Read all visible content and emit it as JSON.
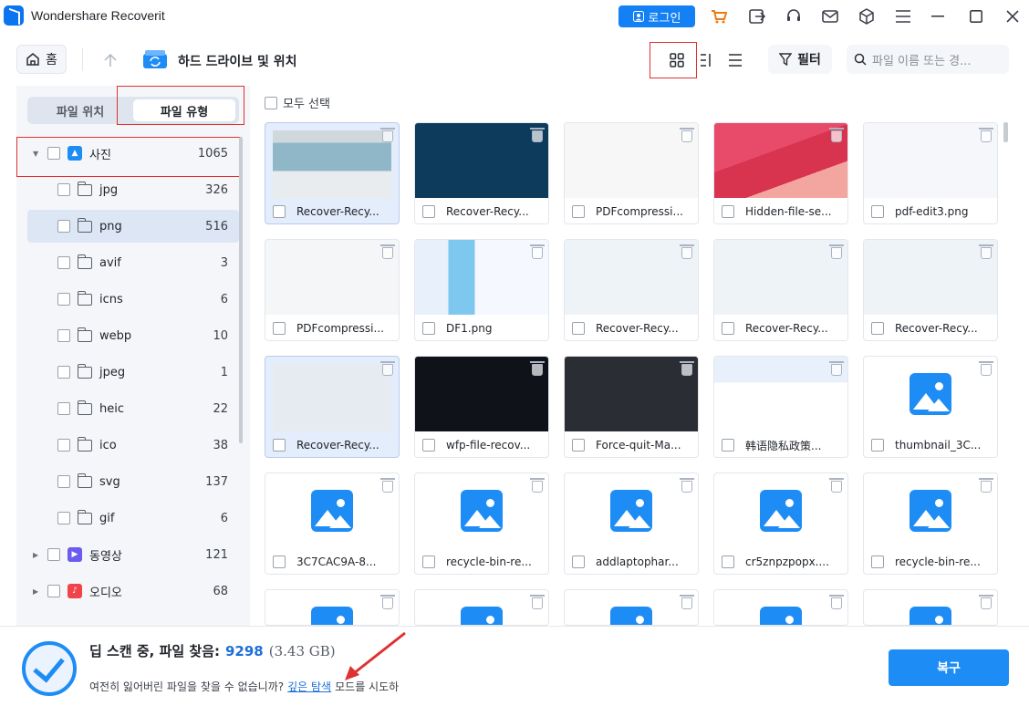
{
  "app": {
    "title": "Wondershare Recoverit",
    "login_label": "로그인"
  },
  "toolbar": {
    "home_label": "홈",
    "location_title": "하드 드라이브 및 위치",
    "filter_label": "필터",
    "search_placeholder": "파일 이름 또는 경..."
  },
  "sidebar": {
    "tabs": [
      {
        "label": "파일 위치"
      },
      {
        "label": "파일 유형"
      }
    ],
    "photo": {
      "label": "사진",
      "count": "1065"
    },
    "subtypes": [
      {
        "label": "jpg",
        "count": "326"
      },
      {
        "label": "png",
        "count": "516"
      },
      {
        "label": "avif",
        "count": "3"
      },
      {
        "label": "icns",
        "count": "6"
      },
      {
        "label": "webp",
        "count": "10"
      },
      {
        "label": "jpeg",
        "count": "1"
      },
      {
        "label": "heic",
        "count": "22"
      },
      {
        "label": "ico",
        "count": "38"
      },
      {
        "label": "svg",
        "count": "137"
      },
      {
        "label": "gif",
        "count": "6"
      }
    ],
    "video": {
      "label": "동영상",
      "count": "121"
    },
    "audio": {
      "label": "오디오",
      "count": "68"
    }
  },
  "main": {
    "select_all_label": "모두 선택",
    "files": [
      {
        "name": "Recover-Recy..."
      },
      {
        "name": "Recover-Recy..."
      },
      {
        "name": "PDFcompressi..."
      },
      {
        "name": "Hidden-file-se..."
      },
      {
        "name": "pdf-edit3.png"
      },
      {
        "name": "PDFcompressi..."
      },
      {
        "name": "DF1.png"
      },
      {
        "name": "Recover-Recy..."
      },
      {
        "name": "Recover-Recy..."
      },
      {
        "name": "Recover-Recy..."
      },
      {
        "name": "Recover-Recy..."
      },
      {
        "name": "wfp-file-recov..."
      },
      {
        "name": "Force-quit-Ma..."
      },
      {
        "name": "韩语隐私政策..."
      },
      {
        "name": "thumbnail_3C..."
      },
      {
        "name": "3C7CAC9A-8..."
      },
      {
        "name": "recycle-bin-re..."
      },
      {
        "name": "addlaptophar..."
      },
      {
        "name": "cr5znpzpopx...."
      },
      {
        "name": "recycle-bin-re..."
      }
    ]
  },
  "status": {
    "scan_text": "딥 스캔 중, 파일 찾음:",
    "file_count": "9298",
    "size": "(3.43 GB)",
    "hint_prefix": "여전히 잃어버린 파일을 찾을 수 없습니까?",
    "hint_link": "깊은 탐색",
    "hint_suffix": "모드를 시도하",
    "recover_label": "복구"
  },
  "colors": {
    "accent": "#1e8cf5",
    "highlight_box": "#e03131"
  }
}
